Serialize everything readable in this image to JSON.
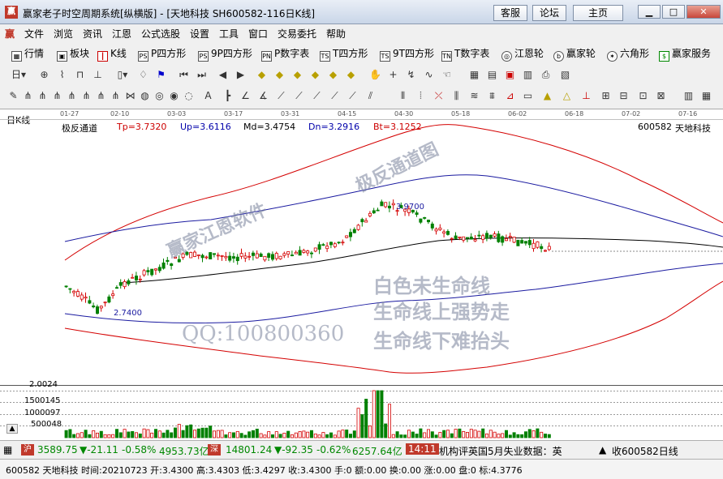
{
  "window": {
    "title": "赢家老子时空周期系统[纵横版] - [天地科技  SH600582-116日K线]",
    "links": [
      "客服",
      "论坛",
      "主页"
    ]
  },
  "menu": [
    "文件",
    "浏览",
    "资讯",
    "江恩",
    "公式选股",
    "设置",
    "工具",
    "窗口",
    "交易委托",
    "帮助"
  ],
  "toolbar1": [
    {
      "icon": "grid-icon",
      "label": "行情"
    },
    {
      "icon": "block-icon",
      "label": "板块"
    },
    {
      "icon": "candle-icon",
      "label": "K线"
    },
    {
      "icon": "PS",
      "label": "P四方形"
    },
    {
      "icon": "PS",
      "label": "9P四方形"
    },
    {
      "icon": "PN",
      "label": "P数字表"
    },
    {
      "icon": "TS",
      "label": "T四方形"
    },
    {
      "icon": "TS",
      "label": "9T四方形"
    },
    {
      "icon": "TN",
      "label": "T数字表"
    },
    {
      "icon": "wheel-icon",
      "label": "江恩轮"
    },
    {
      "icon": "Big",
      "label": "赢家轮"
    },
    {
      "icon": "star-icon",
      "label": "六角形"
    },
    {
      "icon": "dollar-icon",
      "label": "赢家服务"
    }
  ],
  "chart": {
    "corner_label": "日K线",
    "dates": [
      "01-27",
      "02-10",
      "03-03",
      "03-17",
      "03-31",
      "04-15",
      "04-30",
      "05-18",
      "06-02",
      "06-18",
      "07-02",
      "07-16"
    ],
    "indicator": {
      "name": "极反通道",
      "tp": "Tp=3.7320",
      "up": "Up=3.6116",
      "md": "Md=3.4754",
      "dn": "Dn=3.2916",
      "bt": "Bt=3.1252"
    },
    "code_label": "600582",
    "stock_name": "天地科技",
    "price_low": "2.7400",
    "price_high": "3.9700",
    "watermarks": {
      "brand": "赢家江恩软件",
      "channel": "极反通道图",
      "qq": "QQ:100800360",
      "lines": [
        "白色未生命线",
        "生命线上强势走",
        "生命线下难抬头"
      ]
    },
    "volume_scale": [
      "2.0024",
      "1500145",
      "1000097",
      "500048"
    ]
  },
  "chart_data": {
    "type": "candlestick",
    "x": [
      "01-27",
      "02-10",
      "03-03",
      "03-17",
      "03-31",
      "04-15",
      "04-30",
      "05-18",
      "06-02",
      "06-18",
      "07-02",
      "07-16"
    ],
    "annotations": [
      {
        "label": "2.7400"
      },
      {
        "label": "3.9700"
      }
    ],
    "indicator_values": {
      "Tp": 3.732,
      "Up": 3.6116,
      "Md": 3.4754,
      "Dn": 3.2916,
      "Bt": 3.1252
    },
    "volume_ticks": [
      2.0024,
      1500145,
      1000097,
      500048
    ]
  },
  "status": {
    "sh_index": "3589.75",
    "sh_change": "▼-21.11",
    "sh_pct": "-0.58%",
    "sh_amount": "4953.73亿",
    "sz_index": "14801.24",
    "sz_change": "▼-92.35",
    "sz_pct": "-0.62%",
    "sz_amount": "6257.64亿",
    "time": "14:11",
    "news": "机构评英国5月失业数据：英",
    "watch": "收600582日线"
  },
  "info": "600582 天地科技 时间:20210723 开:3.4300 高:3.4303 低:3.4297 收:3.4300 手:0 额:0.00 换:0.00 涨:0.00 盘:0 标:4.3776",
  "colors": {
    "red": "#d40000",
    "blue": "#1a1aa0",
    "green": "#008000",
    "up": "#d40000",
    "down": "#008000"
  }
}
